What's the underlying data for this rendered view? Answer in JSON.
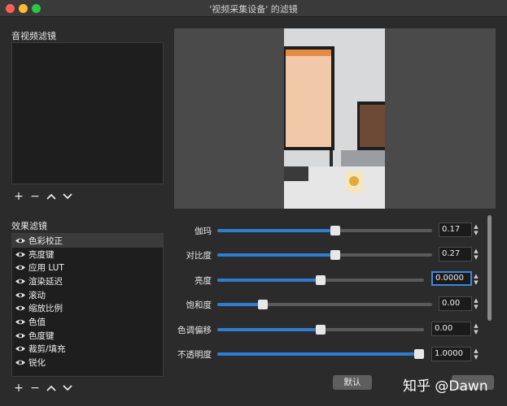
{
  "window": {
    "title": "'视频采集设备' 的滤镜"
  },
  "audio_video_filters": {
    "label": "音视频滤镜",
    "tools": [
      "+",
      "−",
      "^",
      "v"
    ]
  },
  "effect_filters": {
    "label": "效果滤镜",
    "tools": [
      "+",
      "−",
      "^",
      "v"
    ],
    "items": [
      "色彩校正",
      "亮度键",
      "应用 LUT",
      "渲染延迟",
      "滚动",
      "缩放比例",
      "色值",
      "色度键",
      "裁剪/填充",
      "锐化"
    ],
    "selected_index": 0
  },
  "properties": [
    {
      "label": "伽玛",
      "value": "0.17",
      "fraction": 0.55
    },
    {
      "label": "对比度",
      "value": "0.27",
      "fraction": 0.55
    },
    {
      "label": "亮度",
      "value": "0.0000",
      "fraction": 0.5,
      "focused": true
    },
    {
      "label": "饱和度",
      "value": "0.00",
      "fraction": 0.2
    },
    {
      "label": "色调偏移",
      "value": "0.00",
      "fraction": 0.5
    },
    {
      "label": "不透明度",
      "value": "1.0000",
      "fraction": 1.0
    }
  ],
  "buttons": {
    "defaults": "默认"
  },
  "watermark": "知乎 @Dawn"
}
